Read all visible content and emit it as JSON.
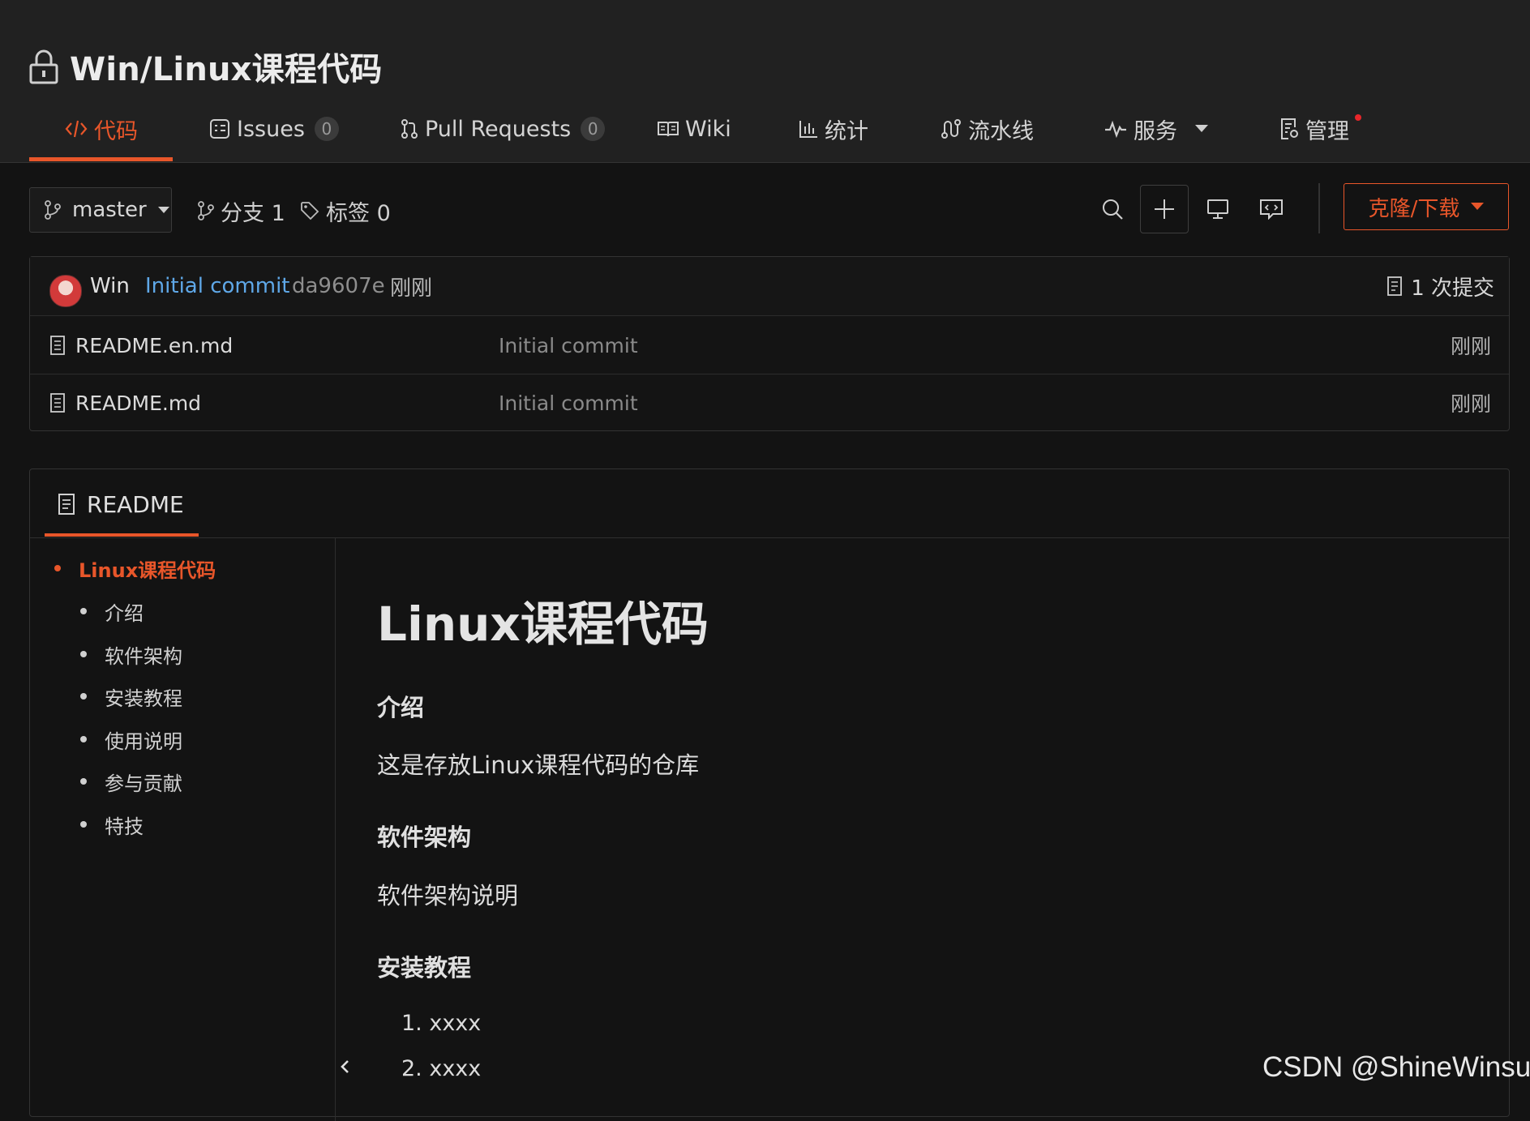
{
  "repo": {
    "title": "Win/Linux课程代码"
  },
  "nav": {
    "tabs": [
      {
        "label": "代码",
        "icon": "code-icon"
      },
      {
        "label": "Issues",
        "icon": "issues-icon",
        "count": "0"
      },
      {
        "label": "Pull Requests",
        "icon": "pull-request-icon",
        "count": "0"
      },
      {
        "label": "Wiki",
        "icon": "wiki-icon"
      },
      {
        "label": "统计",
        "icon": "stats-icon"
      },
      {
        "label": "流水线",
        "icon": "pipeline-icon"
      },
      {
        "label": "服务",
        "icon": "service-icon"
      },
      {
        "label": "管理",
        "icon": "manage-icon"
      }
    ],
    "accent": "#e8562a"
  },
  "toolbar": {
    "branch": "master",
    "branches_label": "分支 1",
    "tags_label": "标签 0",
    "clone_label": "克隆/下载"
  },
  "commit": {
    "author": "Win",
    "message": "Initial commit",
    "hash": "da9607e",
    "time": "刚刚",
    "count_label": "1 次提交"
  },
  "files": [
    {
      "name": "README.en.md",
      "message": "Initial commit",
      "time": "刚刚"
    },
    {
      "name": "README.md",
      "message": "Initial commit",
      "time": "刚刚"
    }
  ],
  "readme": {
    "tab_label": "README",
    "toc": [
      "Linux课程代码",
      "介绍",
      "软件架构",
      "安装教程",
      "使用说明",
      "参与贡献",
      "特技"
    ],
    "title": "Linux课程代码",
    "intro_heading": "介绍",
    "intro_text": "这是存放Linux课程代码的仓库",
    "arch_heading": "软件架构",
    "arch_text": "软件架构说明",
    "install_heading": "安装教程",
    "install_steps": [
      "1. xxxx",
      "2. xxxx"
    ]
  },
  "watermark": "CSDN @ShineWinsu"
}
